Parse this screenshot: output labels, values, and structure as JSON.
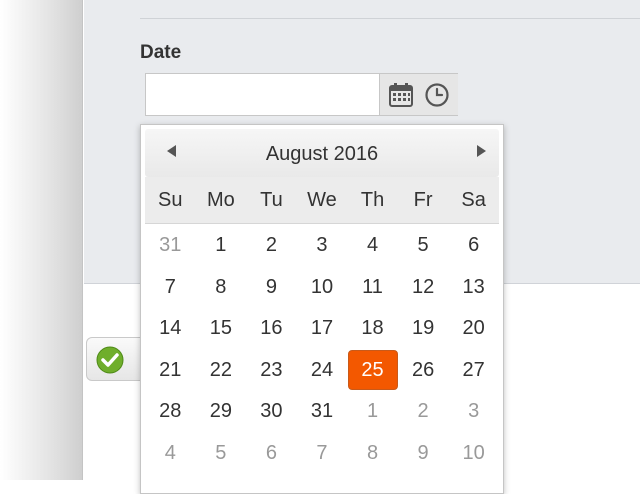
{
  "form": {
    "date_label": "Date",
    "date_value": "",
    "date_placeholder": ""
  },
  "calendar": {
    "title": "August 2016",
    "weekdays": [
      "Su",
      "Mo",
      "Tu",
      "We",
      "Th",
      "Fr",
      "Sa"
    ],
    "weeks": [
      [
        {
          "d": "31",
          "m": true
        },
        {
          "d": "1"
        },
        {
          "d": "2"
        },
        {
          "d": "3"
        },
        {
          "d": "4"
        },
        {
          "d": "5"
        },
        {
          "d": "6"
        }
      ],
      [
        {
          "d": "7"
        },
        {
          "d": "8"
        },
        {
          "d": "9"
        },
        {
          "d": "10"
        },
        {
          "d": "11"
        },
        {
          "d": "12"
        },
        {
          "d": "13"
        }
      ],
      [
        {
          "d": "14"
        },
        {
          "d": "15"
        },
        {
          "d": "16"
        },
        {
          "d": "17"
        },
        {
          "d": "18"
        },
        {
          "d": "19"
        },
        {
          "d": "20"
        }
      ],
      [
        {
          "d": "21"
        },
        {
          "d": "22"
        },
        {
          "d": "23"
        },
        {
          "d": "24"
        },
        {
          "d": "25",
          "s": true
        },
        {
          "d": "26"
        },
        {
          "d": "27"
        }
      ],
      [
        {
          "d": "28"
        },
        {
          "d": "29"
        },
        {
          "d": "30"
        },
        {
          "d": "31"
        },
        {
          "d": "1",
          "m": true
        },
        {
          "d": "2",
          "m": true
        },
        {
          "d": "3",
          "m": true
        }
      ],
      [
        {
          "d": "4",
          "m": true
        },
        {
          "d": "5",
          "m": true
        },
        {
          "d": "6",
          "m": true
        },
        {
          "d": "7",
          "m": true
        },
        {
          "d": "8",
          "m": true
        },
        {
          "d": "9",
          "m": true
        },
        {
          "d": "10",
          "m": true
        }
      ]
    ],
    "selected_color": "#f35800"
  },
  "icons": {
    "calendar": "calendar-icon",
    "clock": "clock-icon",
    "prev": "arrow-left-icon",
    "next": "arrow-right-icon",
    "save": "checkmark-icon"
  }
}
